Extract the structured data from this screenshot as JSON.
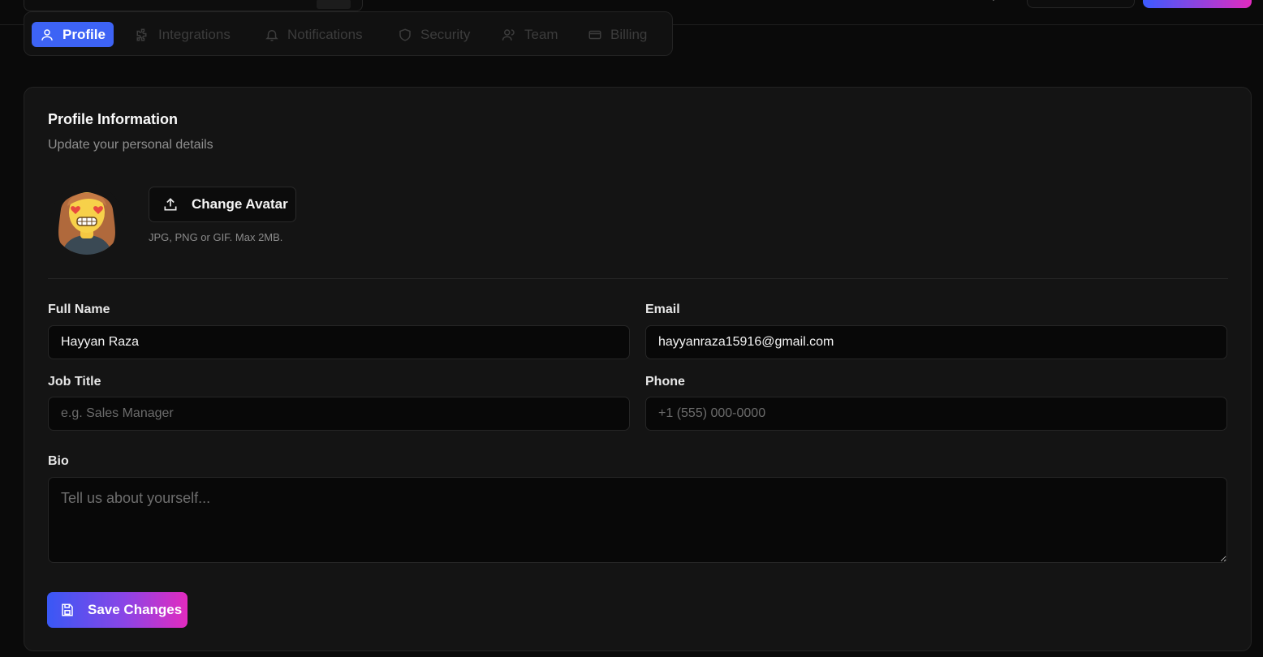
{
  "tabs": [
    {
      "label": "Profile",
      "icon": "user-icon",
      "active": true
    },
    {
      "label": "Integrations",
      "icon": "puzzle-icon",
      "active": false
    },
    {
      "label": "Notifications",
      "icon": "bell-icon",
      "active": false
    },
    {
      "label": "Security",
      "icon": "shield-icon",
      "active": false
    },
    {
      "label": "Team",
      "icon": "users-icon",
      "active": false
    },
    {
      "label": "Billing",
      "icon": "credit-card-icon",
      "active": false
    }
  ],
  "profile": {
    "title": "Profile Information",
    "subtitle": "Update your personal details",
    "change_avatar_label": "Change Avatar",
    "avatar_hint": "JPG, PNG or GIF. Max 2MB."
  },
  "form": {
    "full_name": {
      "label": "Full Name",
      "value": "Hayyan Raza"
    },
    "email": {
      "label": "Email",
      "value": "hayyanraza15916@gmail.com"
    },
    "job_title": {
      "label": "Job Title",
      "value": "",
      "placeholder": "e.g. Sales Manager"
    },
    "phone": {
      "label": "Phone",
      "value": "",
      "placeholder": "+1 (555) 000-0000"
    },
    "bio": {
      "label": "Bio",
      "value": "",
      "placeholder": "Tell us about yourself..."
    }
  },
  "save_label": "Save Changes",
  "colors": {
    "accent": "#3d63f5",
    "gradient_start": "#3958f5",
    "gradient_end": "#e22bbf",
    "background": "#0a0a0a",
    "card": "#141414"
  }
}
